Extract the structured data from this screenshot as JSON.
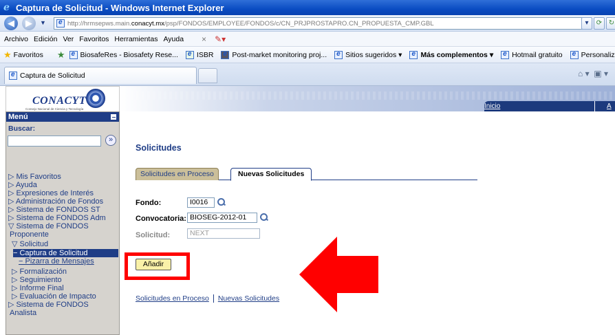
{
  "window": {
    "title": "Captura de Solicitud - Windows Internet Explorer",
    "app_icon": "ie-icon"
  },
  "address": {
    "url_prefix": "http://hrmsepws.main.",
    "url_domain": "conacyt.mx",
    "url_rest": "/psp/FONDOS/EMPLOYEE/FONDOS/c/CN_PRJPROSTAPRO.CN_PROPUESTA_CMP.GBL"
  },
  "menu": {
    "items": [
      "Archivo",
      "Edición",
      "Ver",
      "Favoritos",
      "Herramientas",
      "Ayuda"
    ]
  },
  "favorites": {
    "label": "Favoritos",
    "items": [
      "BiosafeRes - Biosafety Rese...",
      "ISBR",
      "Post-market monitoring proj...",
      "Sitios sugeridos ▾",
      "Más complementos ▾",
      "Hotmail gratuito",
      "Personaliza"
    ]
  },
  "browser_tab": {
    "label": "Captura de Solicitud"
  },
  "portal": {
    "logo": "CONACYT",
    "logo_sub": "Consejo Nacional de Ciencia y Tecnología",
    "nav_home": "Inicio",
    "nav_next": "A"
  },
  "sidebar": {
    "header": "Menú",
    "search_label": "Buscar:",
    "search_value": "",
    "items": [
      {
        "label": "▷ Mis Favoritos"
      },
      {
        "label": "▷ Ayuda"
      },
      {
        "label": "▷ Expresiones de Interés"
      },
      {
        "label": "▷ Administración de Fondos"
      },
      {
        "label": "▷ Sistema de FONDOS ST"
      },
      {
        "label": "▷ Sistema de FONDOS Adm"
      },
      {
        "label": "▽ Sistema de FONDOS"
      },
      {
        "label": "Proponente"
      },
      {
        "label": "▽ Solicitud"
      },
      {
        "label": "− Captura de Solicitud"
      },
      {
        "label": "− Pizarra de Mensajes"
      },
      {
        "label": "▷ Formalización"
      },
      {
        "label": "▷ Seguimiento"
      },
      {
        "label": "▷ Informe Final"
      },
      {
        "label": "▷ Evaluación de Impacto"
      },
      {
        "label": "▷ Sistema de FONDOS"
      },
      {
        "label": "Analista"
      }
    ]
  },
  "main": {
    "title": "Solicitudes",
    "tabs": [
      {
        "label": "Solicitudes en Proceso"
      },
      {
        "label": "Nuevas Solicitudes"
      }
    ],
    "fields": {
      "fondo": {
        "label": "Fondo:",
        "value": "I0016"
      },
      "convocatoria": {
        "label": "Convocatoria:",
        "value": "BIOSEG-2012-01"
      },
      "solicitud": {
        "label": "Solicitud:",
        "value": "NEXT"
      }
    },
    "add_button": "Añadir",
    "bottom_links": [
      "Solicitudes en Proceso",
      "Nuevas Solicitudes"
    ]
  },
  "colors": {
    "accent": "#1f3d86",
    "highlight": "#ff0000",
    "button": "#f9f1a8"
  }
}
